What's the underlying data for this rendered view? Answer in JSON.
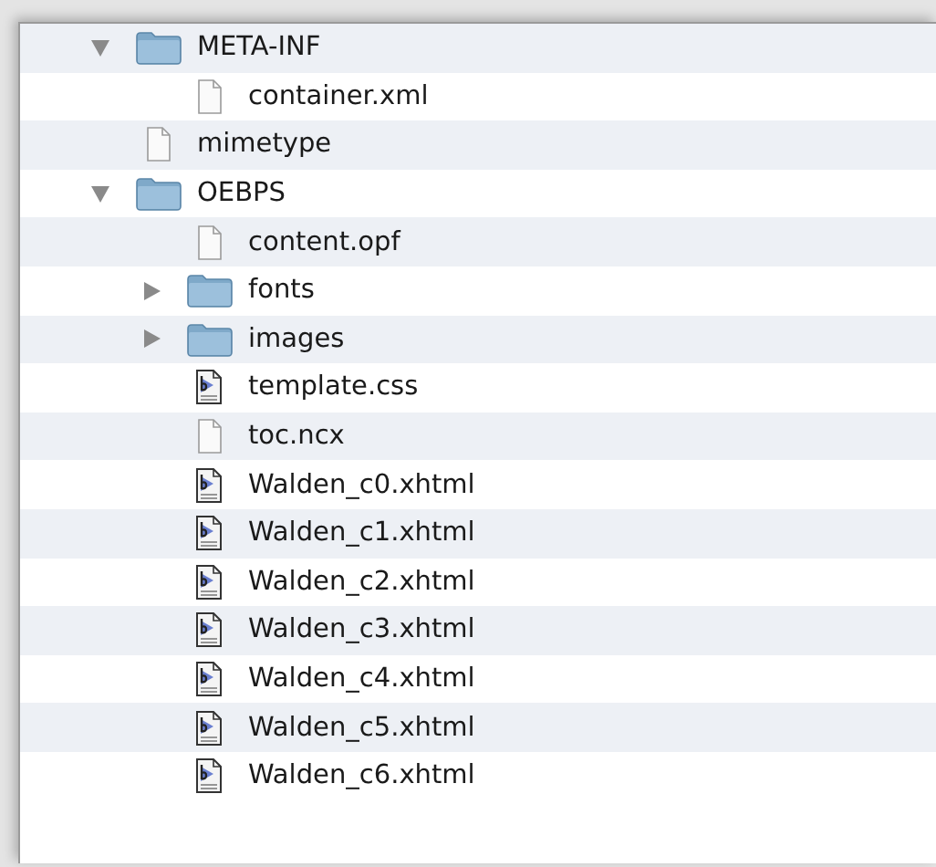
{
  "tree": [
    {
      "name": "META-INF",
      "kind": "folder",
      "expanded": true,
      "children": [
        {
          "name": "container.xml",
          "kind": "file"
        }
      ]
    },
    {
      "name": "mimetype",
      "kind": "file"
    },
    {
      "name": "OEBPS",
      "kind": "folder",
      "expanded": true,
      "children": [
        {
          "name": "content.opf",
          "kind": "file"
        },
        {
          "name": "fonts",
          "kind": "folder",
          "expanded": false
        },
        {
          "name": "images",
          "kind": "folder",
          "expanded": false
        },
        {
          "name": "template.css",
          "kind": "document"
        },
        {
          "name": "toc.ncx",
          "kind": "file"
        },
        {
          "name": "Walden_c0.xhtml",
          "kind": "document"
        },
        {
          "name": "Walden_c1.xhtml",
          "kind": "document"
        },
        {
          "name": "Walden_c2.xhtml",
          "kind": "document"
        },
        {
          "name": "Walden_c3.xhtml",
          "kind": "document"
        },
        {
          "name": "Walden_c4.xhtml",
          "kind": "document"
        },
        {
          "name": "Walden_c5.xhtml",
          "kind": "document"
        },
        {
          "name": "Walden_c6.xhtml",
          "kind": "document"
        }
      ]
    }
  ]
}
